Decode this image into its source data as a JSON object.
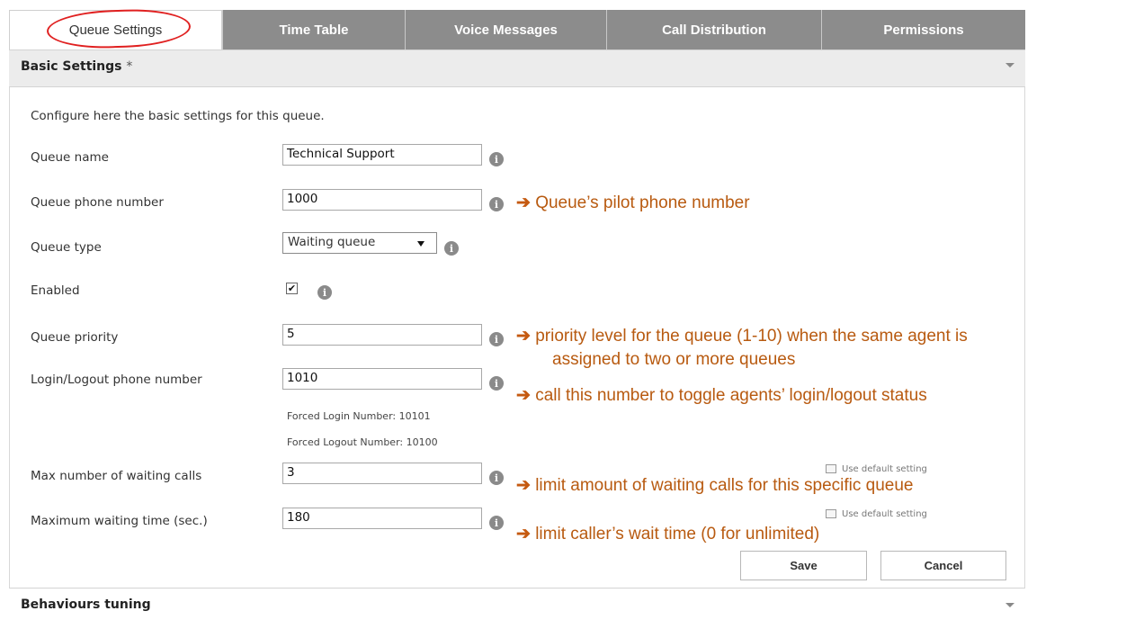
{
  "tabs": [
    {
      "label": "Queue Settings"
    },
    {
      "label": "Time Table"
    },
    {
      "label": "Voice Messages"
    },
    {
      "label": "Call Distribution"
    },
    {
      "label": "Permissions"
    }
  ],
  "basic_settings": {
    "title": "Basic Settings",
    "required_mark": "*",
    "intro": "Configure here the basic settings for this queue.",
    "queue_name": {
      "label": "Queue name",
      "value": "Technical Support"
    },
    "phone_number": {
      "label": "Queue phone number",
      "value": "1000"
    },
    "queue_type": {
      "label": "Queue type",
      "selected": "Waiting queue"
    },
    "enabled": {
      "label": "Enabled",
      "checked": "✔"
    },
    "priority": {
      "label": "Queue priority",
      "value": "5"
    },
    "login_logout": {
      "label": "Login/Logout phone number",
      "value": "1010",
      "forced_login": "Forced Login Number: 10101",
      "forced_logout": "Forced Logout Number: 10100"
    },
    "max_waiting_calls": {
      "label": "Max number of waiting calls",
      "value": "3",
      "default_hint": "Use default setting"
    },
    "max_waiting_time": {
      "label": "Maximum waiting time (sec.)",
      "value": "180",
      "default_hint": "Use default setting"
    },
    "save_label": "Save",
    "cancel_label": "Cancel"
  },
  "behaviours": {
    "title": "Behaviours tuning"
  },
  "annotations": {
    "arrow": "➔",
    "phone_number": "Queue’s pilot phone number",
    "priority_1": "priority level for the queue (1-10) when the same agent is",
    "priority_2": "assigned to two or more queues",
    "login_logout": "call this number to toggle agents’ login/logout status",
    "max_calls": "limit amount of waiting calls for this specific queue",
    "wait_time": "limit caller’s wait time (0 for unlimited)"
  },
  "colors": {
    "tab_bg": "#8c8c8c",
    "annotation": "#b85a10",
    "highlight_circle": "#e02020"
  },
  "icons": {
    "info": "info-icon",
    "dropdown": "chevron-down-icon"
  }
}
